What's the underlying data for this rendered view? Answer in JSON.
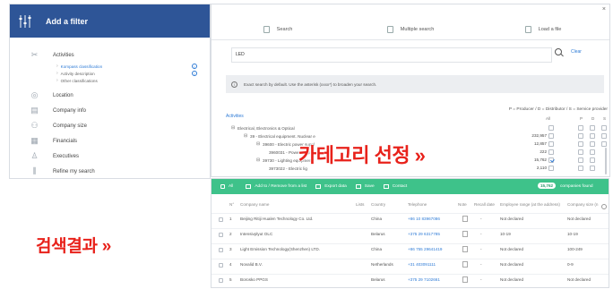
{
  "filter_panel": {
    "title": "Add a filter",
    "icon": "sliders-icon",
    "sections": [
      {
        "label": "Activities",
        "icon": "scissors-icon"
      },
      {
        "label": "Location",
        "icon": "location-pin-icon"
      },
      {
        "label": "Company info",
        "icon": "document-icon"
      },
      {
        "label": "Company size",
        "icon": "people-icon"
      },
      {
        "label": "Financials",
        "icon": "grid-icon"
      },
      {
        "label": "Executives",
        "icon": "person-icon"
      },
      {
        "label": "Refine my search",
        "icon": "sliders-icon"
      }
    ],
    "activity_subitems": [
      "Kompass classification",
      "Activity description",
      "Other classifications"
    ]
  },
  "main_panel": {
    "tabs": [
      {
        "label": "Search",
        "icon": "search-tab-icon"
      },
      {
        "label": "Multiple search",
        "icon": "list-icon"
      },
      {
        "label": "Load a file",
        "icon": "file-icon"
      }
    ],
    "search_value": "LED",
    "clear_label": "Clear",
    "info_text": "Exact search by default. Use the asterisk (xxxx*) to broaden your search.",
    "legend": "P = Producer / D = Distributor / S = Service provider",
    "activities_label": "Activities",
    "columns": {
      "all": "All",
      "p": "P",
      "d": "D",
      "s": "S"
    },
    "tree": [
      {
        "label": "Electrical, Electronics & Optical",
        "count": "",
        "checked": false
      },
      {
        "label": "39 - Electrical equipment. Nuclear e",
        "count": "232,957",
        "checked": false
      },
      {
        "label": "39600 - Electric power suppl",
        "count": "12,857",
        "checked": false
      },
      {
        "label": "3960031 - Power supp",
        "count": "222",
        "checked": false
      },
      {
        "label": "39730 - Lighting equipment,",
        "count": "15,762",
        "checked": true
      },
      {
        "label": "3973022 - Electric lig",
        "count": "2,110",
        "checked": false
      }
    ]
  },
  "results": {
    "toolbar": {
      "all": "All",
      "add_remove": "Add to / Remove from a list",
      "export": "Export data",
      "save": "Save",
      "contact": "Contact"
    },
    "count": "15,762",
    "count_label": "companies found",
    "headers": [
      "N°",
      "Company name",
      "Lists",
      "Country",
      "Telephone",
      "Note",
      "Recall date",
      "Employee range (at the address)",
      "Company size (n"
    ],
    "rows": [
      {
        "n": "1",
        "name": "Beijing Ritiji Hualen Technology Co. Ltd.",
        "country": "China",
        "tel": "+86 10 83967086",
        "recall": "-",
        "employees": "Not declared",
        "size": "Not declared"
      },
      {
        "n": "2",
        "name": "Intensivplyut OLC",
        "country": "Belarus",
        "tel": "+375 29 6317785",
        "recall": "-",
        "employees": "10-19",
        "size": "10-19"
      },
      {
        "n": "3",
        "name": "Light Emission Technology(Shenzhen) LTD.",
        "country": "China",
        "tel": "+86 755 29641419",
        "recall": "-",
        "employees": "Not declared",
        "size": "100-249"
      },
      {
        "n": "4",
        "name": "Novalid B.V.",
        "country": "Netherlands",
        "tel": "+31 403091111",
        "recall": "-",
        "employees": "Not declared",
        "size": "0-9"
      },
      {
        "n": "5",
        "name": "Borosko PPGS",
        "country": "Belarus",
        "tel": "+375 29 7102661",
        "recall": "-",
        "employees": "Not declared",
        "size": "Not declared"
      }
    ]
  },
  "annotations": {
    "category": "카테고리 선정 »",
    "results": "검색결과 »"
  },
  "colors": {
    "header_blue": "#2e5597",
    "results_green": "#3ec28a",
    "accent_red": "#e8221b",
    "link_blue": "#2e7bd6"
  }
}
